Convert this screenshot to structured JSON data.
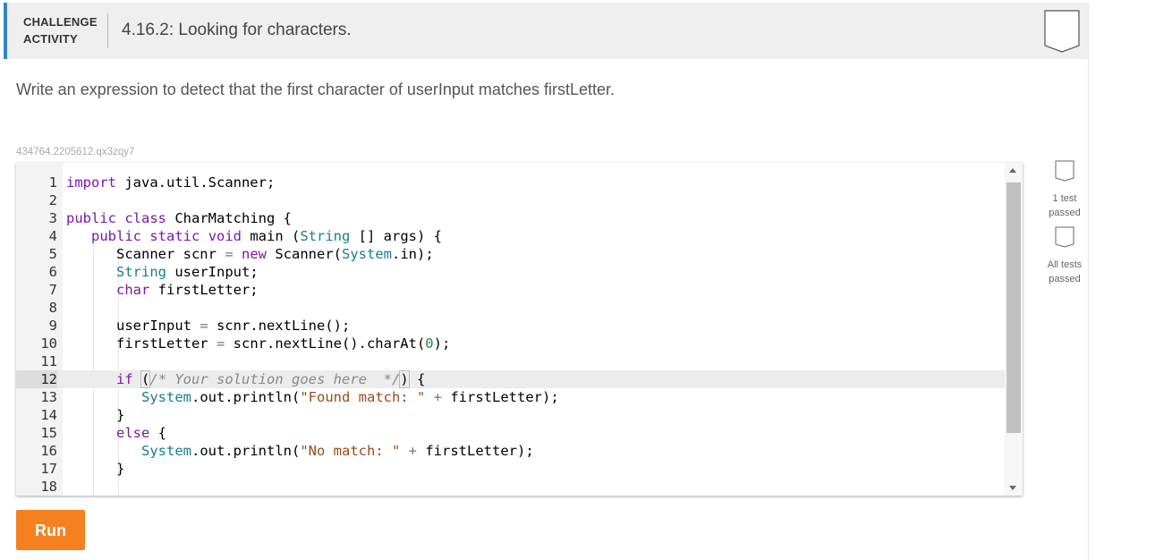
{
  "header": {
    "badge_line1": "CHALLENGE",
    "badge_line2": "ACTIVITY",
    "title": "4.16.2: Looking for characters.",
    "accent_color": "#2f87c7"
  },
  "instruction": "Write an expression to detect that the first character of userInput matches firstLetter.",
  "code_id": "434764.2205612.qx3zqy7",
  "editor": {
    "active_line": 12,
    "line_numbers": [
      "1",
      "2",
      "3",
      "4",
      "5",
      "6",
      "7",
      "8",
      "9",
      "10",
      "11",
      "12",
      "13",
      "14",
      "15",
      "16",
      "17",
      "18"
    ]
  },
  "run_button": {
    "label": "Run",
    "color": "#f5801f"
  },
  "status": {
    "one_test_line1": "1 test",
    "one_test_line2": "passed",
    "all_tests_line1": "All tests",
    "all_tests_line2": "passed"
  },
  "icons": {
    "bookmark": "bookmark-icon",
    "test_status": "test-status-icon"
  }
}
